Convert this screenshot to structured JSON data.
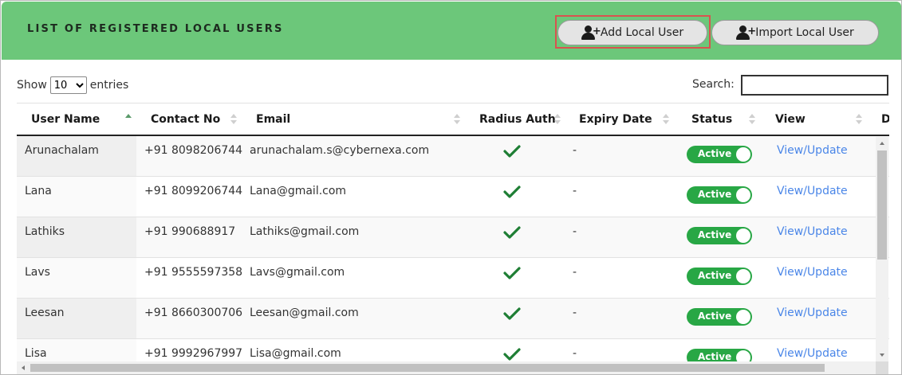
{
  "header": {
    "title": "LIST OF REGISTERED LOCAL USERS",
    "add_button": "Add Local User",
    "import_button": "Import Local User",
    "button_icon": "user-plus-icon",
    "background_color": "#6cc77a",
    "highlight_color": "#d9534f"
  },
  "controls": {
    "show_label": "Show",
    "entries_value": "10",
    "entries_label": "entries",
    "search_label": "Search:",
    "search_value": ""
  },
  "table": {
    "columns": [
      "User Name",
      "Contact No",
      "Email",
      "Radius Auth",
      "Expiry Date",
      "Status",
      "View",
      "D"
    ],
    "sorted_column": "User Name",
    "sort_direction": "ascending",
    "rows": [
      {
        "name": "Arunachalam",
        "contact": "+91 8098206744",
        "email": "arunachalam.s@cybernexa.com",
        "radius_auth": true,
        "expiry": "-",
        "status": "Active",
        "view": "View/Update"
      },
      {
        "name": "Lana",
        "contact": "+91 8099206744",
        "email": "Lana@gmail.com",
        "radius_auth": true,
        "expiry": "-",
        "status": "Active",
        "view": "View/Update"
      },
      {
        "name": "Lathiks",
        "contact": "+91 990688917",
        "email": "Lathiks@gmail.com",
        "radius_auth": true,
        "expiry": "-",
        "status": "Active",
        "view": "View/Update"
      },
      {
        "name": "Lavs",
        "contact": "+91 9555597358",
        "email": "Lavs@gmail.com",
        "radius_auth": true,
        "expiry": "-",
        "status": "Active",
        "view": "View/Update"
      },
      {
        "name": "Leesan",
        "contact": "+91 8660300706",
        "email": "Leesan@gmail.com",
        "radius_auth": true,
        "expiry": "-",
        "status": "Active",
        "view": "View/Update"
      },
      {
        "name": "Lisa",
        "contact": "+91 9992967997",
        "email": "Lisa@gmail.com",
        "radius_auth": true,
        "expiry": "-",
        "status": "Active",
        "view": "View/Update"
      }
    ],
    "status_color": "#28a745",
    "link_color": "#4a86e8",
    "check_color": "#1e7e34"
  }
}
